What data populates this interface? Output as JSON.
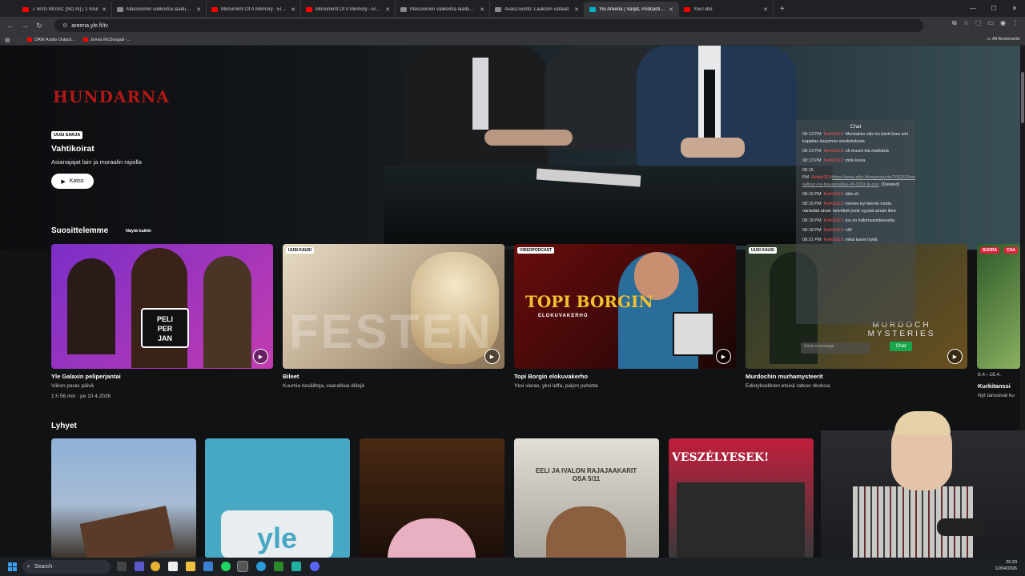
{
  "browser": {
    "tabs": [
      {
        "title": "♫ BUG MUSIC [NO AI] | 1 hour",
        "icon": "youtube-icon",
        "active": false
      },
      {
        "title": "Massiivinen valikoima laadukkaita",
        "icon": "page-icon",
        "active": false
      },
      {
        "title": "Monument Of A Memory - Elokuva",
        "icon": "youtube-icon",
        "active": false
      },
      {
        "title": "Monument Of A Memory - Elokuva",
        "icon": "youtube-icon",
        "active": false
      },
      {
        "title": "Massiivinen valikoima laadukkaita",
        "icon": "page-icon",
        "active": false
      },
      {
        "title": "Avara luonto: Laakson valtiaat",
        "icon": "page-icon",
        "active": false
      },
      {
        "title": "Yle Areena | Sarjat, Podcastit, Suorat",
        "icon": "yle-icon",
        "active": true
      },
      {
        "title": "YouTube",
        "icon": "youtube-icon",
        "active": false
      }
    ],
    "new_tab": "+",
    "url": "areena.yle.fi/tv",
    "bookmarks": [
      {
        "label": "DAW Audio Output..."
      },
      {
        "label": "Jenna McDougall -..."
      }
    ],
    "all_bookmarks": "All Bookmarks"
  },
  "hero": {
    "logo_text": "HUNDARNA",
    "badge": "UUSI SARJA",
    "title": "Vahtikoirat",
    "description": "Asianajajat lain ja moraalin rajoilla",
    "watch_label": "Katso"
  },
  "recommended": {
    "title": "Suosittelemme",
    "see_all": "Näytä kaikki",
    "cards": [
      {
        "badge": "",
        "title": "Yle Galaxin peliperjantai",
        "subtitle": "Viikon paras päivä",
        "meta": "1 h 56 min  ·  pe 10.4.2026",
        "colors": [
          "#7a2ec8",
          "#c23cb0"
        ]
      },
      {
        "badge": "UUSI KAUSI",
        "title": "Bileet",
        "subtitle": "Kuumia kesäiltoja, vaarallisia diilejä",
        "meta": "",
        "overlay_text": "FESTEN",
        "colors": [
          "#d8c4a4",
          "#8a7256"
        ]
      },
      {
        "badge": "VIDEOPODCAST",
        "title": "Topi Borgin elokuvakerho",
        "subtitle": "Yksi vieras, yksi leffa, paljon puhetta",
        "meta": "",
        "overlay_text": "TOPI BORGIN",
        "overlay_sub": "ELOKUVAKERHO",
        "colors": [
          "#6a0c0c",
          "#1a0606"
        ]
      },
      {
        "badge": "UUSI KAUSI",
        "title": "Murdochin murhamysteerit",
        "subtitle": "Edistyksellinen etsivä ratkoo rikoksia",
        "meta": "",
        "overlay_text": "MURDOCH MYSTERIES",
        "colors": [
          "#2a3a2c",
          "#6a5020"
        ]
      },
      {
        "badge": "SUORA",
        "badge2": "CHA",
        "title": "Kurkitanssi",
        "subtitle": "Nyt tanssivat ku",
        "meta": "8.4.–18.4.",
        "colors": [
          "#2f5a2a",
          "#8ab060"
        ]
      }
    ]
  },
  "shorts": {
    "title": "Lyhyet",
    "items": [
      {
        "caption": "",
        "colors": [
          "#8fb0d8",
          "#3a3026"
        ]
      },
      {
        "caption": "yle",
        "colors": [
          "#47a8c4",
          "#3aa0bc"
        ]
      },
      {
        "caption": "",
        "colors": [
          "#4a2a14",
          "#e8b0c0"
        ]
      },
      {
        "caption": "EELI JA IVALON RAJAJAAKARIT OSA 5/11",
        "colors": [
          "#d8d4cc",
          "#a8a49c"
        ]
      },
      {
        "caption": "VESZÉLYESEK!",
        "colors": [
          "#c01e3c",
          "#3a3a3a"
        ]
      },
      {
        "caption": "",
        "colors": [
          "#3a3c40",
          "#7ac83a"
        ]
      }
    ]
  },
  "chat": {
    "title": "Chat",
    "messages": [
      {
        "time": "08:13 PM",
        "user": "Kerkki112",
        "text": ": Muistakko silio ku kävit lives siel kuppilas karjumas siankidutusta"
      },
      {
        "time": "08:13 PM",
        "user": "Kerkki112",
        "text": ": oli muorit iha märkänä"
      },
      {
        "time": "08:13 PM",
        "user": "Kerkki112",
        "text": ": mitä kuvia"
      },
      {
        "time": "08:15 PM",
        "user": "Kerkki112",
        "text": ":",
        "link": "https://www.alko.fi/en/products/700252/hard-seltzer-ice-tea-persikka-45-0331-tk-can",
        "suffix": "(Deleted)"
      },
      {
        "time": "08:15 PM",
        "user": "Kerkki112",
        "text": ": tätä oli"
      },
      {
        "time": "08:16 PM",
        "user": "Kerkki112",
        "text": ": menee kyl ikeniin mutta närästää aivan helvetisti joste syystä ainaki iltee"
      },
      {
        "time": "08:18 PM",
        "user": "Kerkki112",
        "text": ": jos on tutkimusvideoustia"
      },
      {
        "time": "08:18 PM",
        "user": "Kerkki112",
        "text": ": nW"
      },
      {
        "time": "08:21 PM",
        "user": "Kerkki112",
        "text": ": mikä kaevi tyyliä"
      }
    ],
    "input_placeholder": "Send a message",
    "send_label": "Chat"
  },
  "taskbar": {
    "search_label": "Search",
    "time": "20.23",
    "date": "12/04/2026"
  }
}
